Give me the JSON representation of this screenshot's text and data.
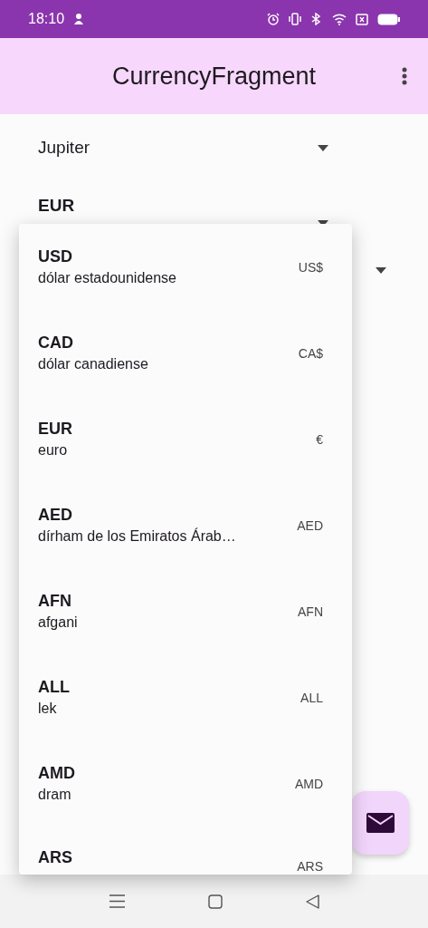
{
  "status_bar": {
    "time": "18:10"
  },
  "app_bar": {
    "title": "CurrencyFragment"
  },
  "spinners": [
    {
      "value": "Jupiter"
    },
    {
      "value": "EUR"
    }
  ],
  "dropdown": {
    "items": [
      {
        "code": "USD",
        "name": "dólar estadounidense",
        "symbol": "US$"
      },
      {
        "code": "CAD",
        "name": "dólar canadiense",
        "symbol": "CA$"
      },
      {
        "code": "EUR",
        "name": "euro",
        "symbol": "€"
      },
      {
        "code": "AED",
        "name": "dírham de los Emiratos Árab…",
        "symbol": "AED"
      },
      {
        "code": "AFN",
        "name": "afgani",
        "symbol": "AFN"
      },
      {
        "code": "ALL",
        "name": "lek",
        "symbol": "ALL"
      },
      {
        "code": "AMD",
        "name": "dram",
        "symbol": "AMD"
      },
      {
        "code": "ARS",
        "symbol": "ARS"
      }
    ]
  }
}
